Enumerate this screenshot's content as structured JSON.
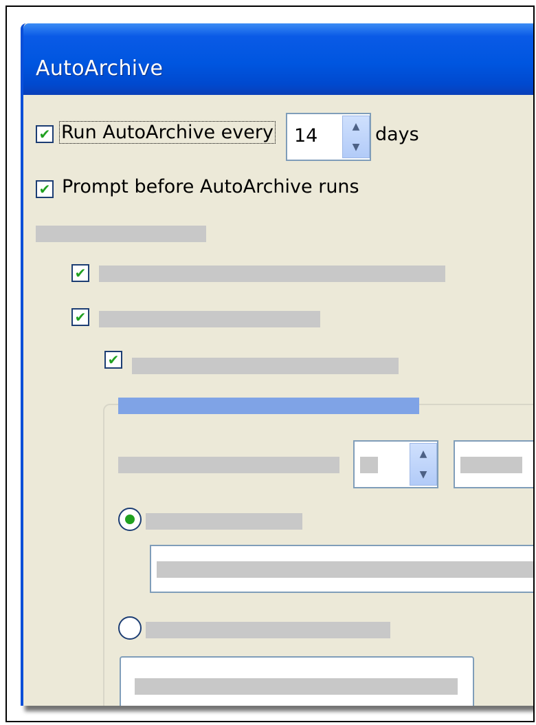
{
  "window": {
    "title": "AutoArchive"
  },
  "options": {
    "run_every": {
      "label": "Run AutoArchive every",
      "checked": true,
      "value": "14",
      "unit": "days"
    },
    "prompt_before": {
      "label": "Prompt before AutoArchive runs",
      "checked": true
    }
  },
  "icons": {
    "check": "✔",
    "spin_up": "▲",
    "spin_down": "▼"
  },
  "colors": {
    "titlebar": "#0056e0",
    "window_bg": "#ece9d8",
    "check_green": "#21a121",
    "placeholder_gray": "#c8c8c8",
    "placeholder_blue": "#7fa3e6"
  }
}
